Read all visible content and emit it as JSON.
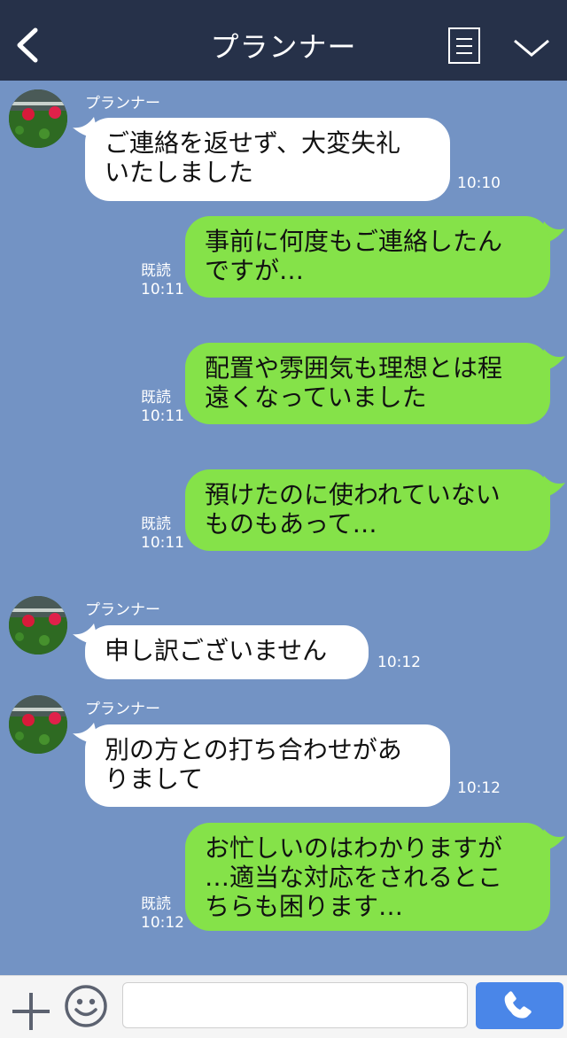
{
  "header": {
    "title": "プランナー"
  },
  "messages": [
    {
      "sender": "プランナー",
      "lines": [
        "ご連絡を返せず、大変失礼",
        "いたしました"
      ],
      "time": "10:10"
    },
    {
      "read": "既読",
      "time": "10:11",
      "lines": [
        "事前に何度もご連絡したん",
        "ですが…"
      ]
    },
    {
      "read": "既読",
      "time": "10:11",
      "lines": [
        "配置や雰囲気も理想とは程",
        "遠くなっていました"
      ]
    },
    {
      "read": "既読",
      "time": "10:11",
      "lines": [
        "預けたのに使われていない",
        "ものもあって…"
      ]
    },
    {
      "sender": "プランナー",
      "lines": [
        "申し訳ございません"
      ],
      "time": "10:12"
    },
    {
      "sender": "プランナー",
      "lines": [
        "別の方との打ち合わせがあ",
        "りまして"
      ],
      "time": "10:12"
    },
    {
      "read": "既読",
      "time": "10:12",
      "lines": [
        "お忙しいのはわかりますが",
        "…適当な対応をされるとこ",
        "ちらも困ります…"
      ]
    }
  ],
  "footer": {
    "input_placeholder": ""
  },
  "colors": {
    "header": "#263149",
    "background": "#7393c4",
    "outgoing": "#85e249",
    "incoming": "#ffffff",
    "call_button": "#4a86e8"
  },
  "icons": [
    "back-arrow-icon",
    "menu-icon",
    "chevron-down-icon",
    "plus-icon",
    "emoji-icon",
    "phone-icon"
  ]
}
